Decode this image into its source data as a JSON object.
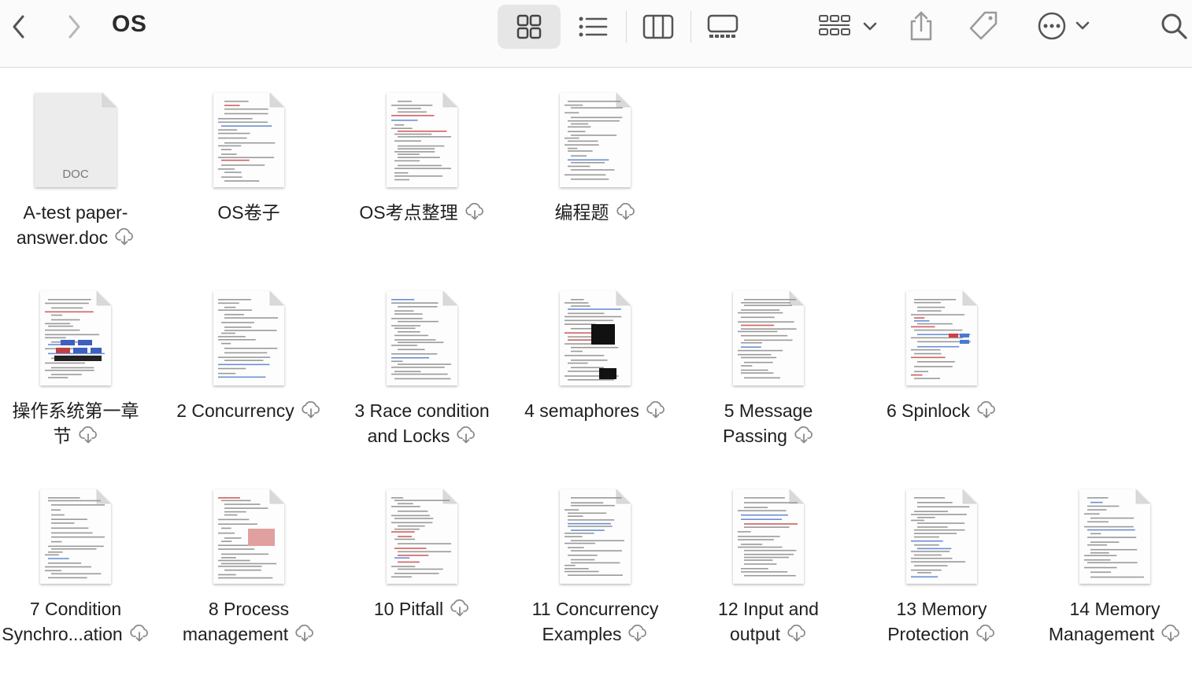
{
  "window": {
    "title": "OS"
  },
  "toolbar": {
    "icons": [
      "chevron-left-icon",
      "chevron-right-icon",
      "grid-view-icon",
      "list-view-icon",
      "column-view-icon",
      "gallery-view-icon",
      "group-icon",
      "share-icon",
      "tag-icon",
      "more-icon",
      "search-icon"
    ]
  },
  "files": [
    {
      "name": "A-test paper-answer.doc",
      "line1": "A-test paper-",
      "line2": "answer.doc",
      "kind": "DOC",
      "cloud": true
    },
    {
      "name": "OS卷子",
      "line1": "OS卷子",
      "line2": "",
      "cloud": false
    },
    {
      "name": "OS考点整理",
      "line1": "OS考点整理",
      "line2": "",
      "cloud": true
    },
    {
      "name": "编程题",
      "line1": "编程题",
      "line2": "",
      "cloud": true
    },
    {
      "name": "操作系统第一章节",
      "line1": "操作系统第一章",
      "line2": "节",
      "cloud": true
    },
    {
      "name": "2 Concurrency",
      "line1": "2 Concurrency",
      "line2": "",
      "cloud": true
    },
    {
      "name": "3 Race condition and Locks",
      "line1": "3 Race condition",
      "line2": "and Locks",
      "cloud": true
    },
    {
      "name": "4 semaphores",
      "line1": "4 semaphores",
      "line2": "",
      "cloud": true
    },
    {
      "name": "5 Message Passing",
      "line1": "5 Message",
      "line2": "Passing",
      "cloud": true
    },
    {
      "name": "6 Spinlock",
      "line1": "6 Spinlock",
      "line2": "",
      "cloud": true
    },
    {
      "name": "7 Condition Synchro...ation",
      "line1": "7 Condition",
      "line2": "Synchro...ation",
      "cloud": true
    },
    {
      "name": "8 Process management",
      "line1": "8 Process",
      "line2": "management",
      "cloud": true
    },
    {
      "name": "10 Pitfall",
      "line1": "10 Pitfall",
      "line2": "",
      "cloud": true
    },
    {
      "name": "11 Concurrency Examples",
      "line1": "11  Concurrency",
      "line2": "Examples",
      "cloud": true
    },
    {
      "name": "12 Input and output",
      "line1": "12 Input and",
      "line2": "output",
      "cloud": true
    },
    {
      "name": "13 Memory Protection",
      "line1": "13 Memory",
      "line2": "Protection",
      "cloud": true
    },
    {
      "name": "14 Memory Management",
      "line1": "14 Memory",
      "line2": "Management",
      "cloud": true
    }
  ]
}
